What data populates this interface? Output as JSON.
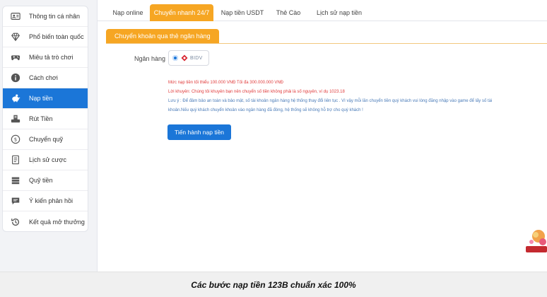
{
  "sidebar": {
    "items": [
      {
        "label": "Thông tin cá nhân",
        "icon": "user-card-icon"
      },
      {
        "label": "Phổ biến toàn quốc",
        "icon": "diamond-icon"
      },
      {
        "label": "Miêu tả trò chơi",
        "icon": "gamepad-icon"
      },
      {
        "label": "Cách chơi",
        "icon": "info-icon"
      },
      {
        "label": "Nạp tiền",
        "icon": "piggy-bank-icon"
      },
      {
        "label": "Rút Tiền",
        "icon": "withdraw-icon"
      },
      {
        "label": "Chuyển quỹ",
        "icon": "transfer-icon"
      },
      {
        "label": "Lịch sử cược",
        "icon": "bet-history-icon"
      },
      {
        "label": "Quỹ tiền",
        "icon": "fund-icon"
      },
      {
        "label": "Ý kiến phản hồi",
        "icon": "feedback-icon"
      },
      {
        "label": "Kết quả mở thưởng",
        "icon": "history-icon"
      }
    ],
    "active_index": 4
  },
  "tabs": [
    "Nạp online",
    "Chuyển nhanh 24/7",
    "Nạp tiền USDT",
    "Thẻ Cào",
    "Lịch sử nạp tiền"
  ],
  "active_tab": 1,
  "subtab": "Chuyển khoản qua thẻ ngân hàng",
  "bank": {
    "label": "Ngân hàng",
    "option": "BIDV"
  },
  "notes": {
    "limit": "Mức nạp tiền tối thiểu 100.000 VNĐ Tối đa 300.000.000 VNĐ",
    "advice": "Lời khuyên: Chúng tôi khuyên bạn nên chuyển số tiền không phải là số nguyên, ví dụ 1023.18",
    "caution_1": "Lưu ý : Để đảm bảo an toàn và bảo mật, số tài khoản ngân hàng hệ thống thay đổi liên tục . Vì vậy mỗi lần chuyển tiền quý khách vui lòng đăng nhập vào game để lấy số tài",
    "caution_2": "khoản.Nếu quý khách chuyển khoản vào ngân hàng đã đóng, hệ thống sẽ không hỗ trợ cho quý khách !"
  },
  "submit_label": "Tiến hành nạp tiền",
  "caption": "Các bước nạp tiền 123B chuẩn xác 100%",
  "colors": {
    "accent": "#1b76d8",
    "tab_active": "#f6a623",
    "warning": "#e03b3b"
  }
}
